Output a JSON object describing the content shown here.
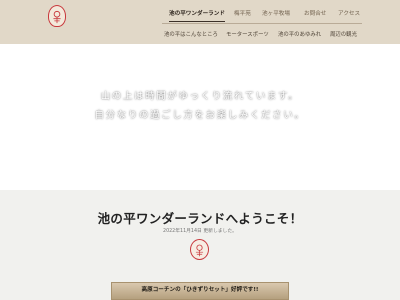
{
  "header": {
    "logo_alt": "logo",
    "nav_top": [
      {
        "label": "池の平ワンダーランド",
        "active": true
      },
      {
        "label": "梅平苑",
        "active": false
      },
      {
        "label": "池ヶ平牧場",
        "active": false
      },
      {
        "label": "お問合せ",
        "active": false
      },
      {
        "label": "アクセス",
        "active": false
      }
    ],
    "nav_sub": [
      {
        "label": "池の平はこんなところ"
      },
      {
        "label": "モータースポーツ"
      },
      {
        "label": "池の平のあゆみれ"
      },
      {
        "label": "周辺の観光"
      }
    ]
  },
  "hero": {
    "line1": "山の上は時間がゆっくり流れています。",
    "line2": "自分なりの過ごし方をお楽しみください。"
  },
  "welcome": {
    "title": "池の平ワンダーランドへようこそ！",
    "date": "2022年11月14日 更新しました。",
    "banner": "高原コーチンの「ひきずりセット」好評です!!"
  },
  "colors": {
    "header_bg": "#e1d8c8",
    "accent_red": "#c8383c",
    "welcome_bg": "#f1f1ee"
  }
}
